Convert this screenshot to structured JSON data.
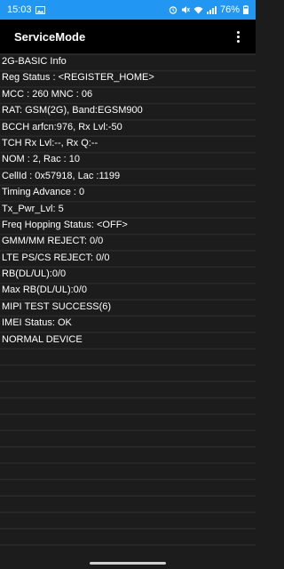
{
  "status_bar": {
    "time": "15:03",
    "battery": "76%",
    "icons": [
      "image-icon",
      "alarm-icon",
      "mute-icon",
      "wifi-icon",
      "signal-icon",
      "battery-icon"
    ]
  },
  "app_bar": {
    "title": "ServiceMode",
    "menu_icon": "more-vert-icon"
  },
  "lines": [
    "2G-BASIC Info",
    "Reg Status : <REGISTER_HOME>",
    "MCC : 260 MNC : 06",
    "RAT: GSM(2G), Band:EGSM900",
    "BCCH arfcn:976, Rx Lvl:-50",
    "TCH Rx Lvl:--, Rx Q:--",
    "NOM : 2, Rac : 10",
    "CellId : 0x57918, Lac :1199",
    "Timing Advance : 0",
    "Tx_Pwr_Lvl: 5",
    "Freq Hopping Status: <OFF>",
    "GMM/MM REJECT: 0/0",
    "LTE PS/CS REJECT: 0/0",
    "RB(DL/UL):0/0",
    "Max RB(DL/UL):0/0",
    "MIPI TEST SUCCESS(6)",
    "IMEI Status: OK",
    "NORMAL DEVICE"
  ],
  "colors": {
    "status_bar": "#2196f3",
    "app_bar": "#000000",
    "background": "#1c1c1c",
    "text": "#ffffff",
    "divider": "#2a2a2a"
  }
}
